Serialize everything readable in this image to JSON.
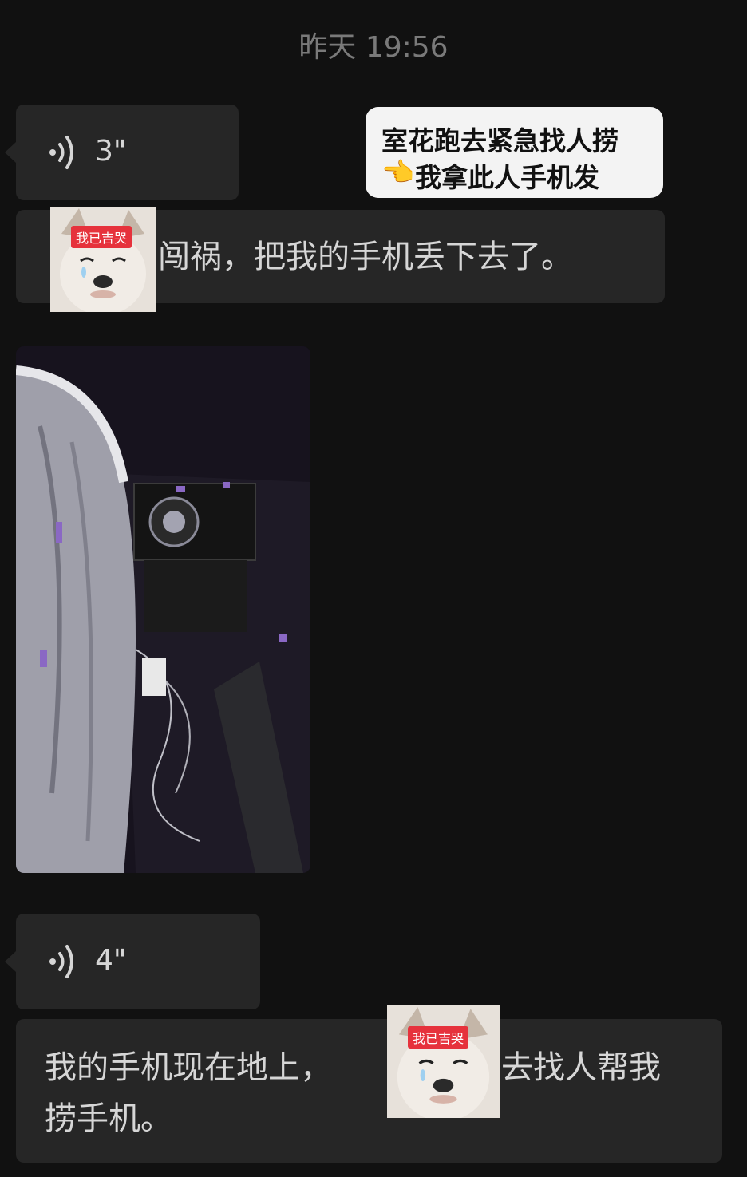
{
  "header": {
    "timestamp": "昨天 19:56"
  },
  "messages": [
    {
      "type": "voice",
      "duration": "3\""
    },
    {
      "type": "caption_overlay",
      "line1": "室花跑去紧急找人捞",
      "line2_emoji": "👈",
      "line2": "我拿此人手机发"
    },
    {
      "type": "text_with_sticker",
      "sticker_badge": "我已吉哭",
      "text": "闯祸，把我的手机丢下去了。"
    },
    {
      "type": "image"
    },
    {
      "type": "voice",
      "duration": "4\""
    },
    {
      "type": "text_with_sticker",
      "line1_before": "我的手机现在地上，",
      "sticker_badge": "我已吉哭",
      "line1_after": "去找人帮我",
      "line2": "捞手机。"
    }
  ],
  "icons": {
    "voice": "voice-wave-icon",
    "sticker": "crying-dog-sticker"
  },
  "colors": {
    "background": "#111111",
    "bubble": "#262626",
    "text": "#d6d6d6",
    "timestamp": "#7a7a7a",
    "badge": "#e6323c",
    "caption_bg": "#f3f3f3"
  }
}
